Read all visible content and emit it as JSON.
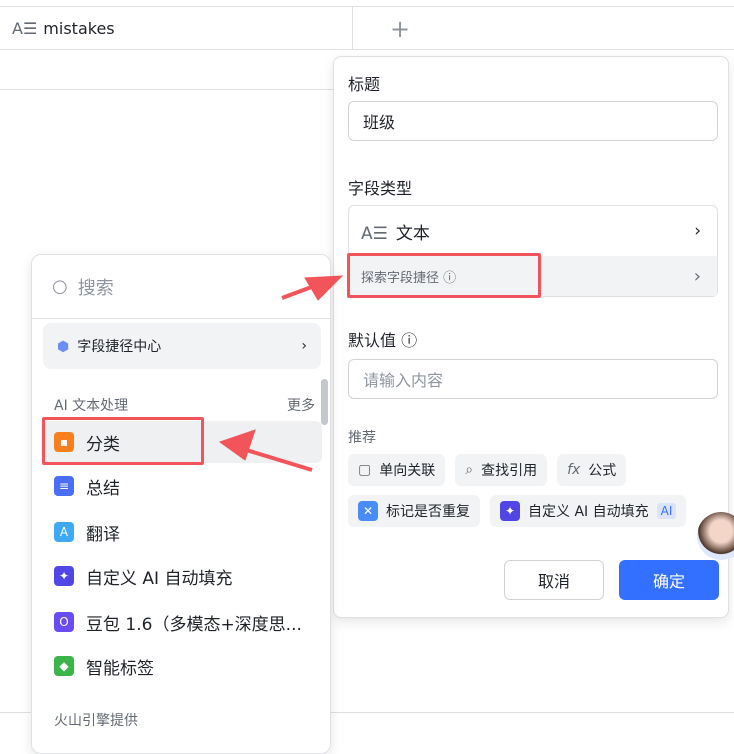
{
  "table": {
    "column_name": "mistakes",
    "add_label": "+"
  },
  "panel": {
    "title_label": "标题",
    "title_value": "班级",
    "type_label": "字段类型",
    "type_value": "文本",
    "explore_label": "探索字段捷径",
    "default_label": "默认值",
    "default_placeholder": "请输入内容",
    "recommend_label": "推荐",
    "recommend": [
      "单向关联",
      "查找引用",
      "公式",
      "标记是否重复",
      "自定义 AI 自动填充"
    ],
    "ai_badge": "AI",
    "cancel": "取消",
    "confirm": "确定"
  },
  "menu": {
    "search_placeholder": "搜索",
    "center": "字段捷径中心",
    "section": "AI 文本处理",
    "more": "更多",
    "items": [
      "分类",
      "总结",
      "翻译",
      "自定义 AI 自动填充",
      "豆包 1.6（多模态+深度思...",
      "智能标签"
    ],
    "footer": "火山引擎提供"
  },
  "colors": {
    "accent": "#3370ff",
    "highlight": "#f2545b"
  }
}
